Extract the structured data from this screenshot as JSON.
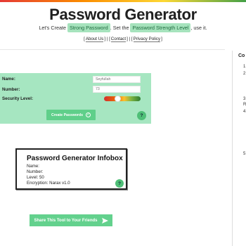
{
  "header": {
    "title": "Password Generator",
    "subtitle": {
      "prefix": "Let's Create",
      "highlight1": "Strong Password",
      "middle": ". Set the",
      "highlight2": "Password Strength Level",
      "suffix": ", use it."
    },
    "links": {
      "about": "About Us",
      "contact": "Contact",
      "privacy": "Privacy Policy"
    }
  },
  "form": {
    "name_label": "Name:",
    "name_placeholder": "Seyfullah",
    "number_label": "Number:",
    "number_placeholder": "73",
    "security_label": "Security Level:",
    "security_level_fraction": 0.35,
    "create_button": "Create Passwords",
    "help": "?"
  },
  "infobox": {
    "title": "Password Generator Infobox",
    "name_line": "Name:",
    "number_line": "Number:",
    "level_line": "Level: 50",
    "encryption_line": "Encryption: Narax v1.0",
    "help": "?"
  },
  "share_button": "Share This Tool to Your Friends",
  "right_panel": {
    "heading": "Co",
    "items": [
      "1.",
      "2.",
      "3.",
      "R",
      "4.",
      "5."
    ]
  },
  "colors": {
    "accent_green": "#63d18d",
    "panel_green": "#a6e6c1",
    "highlight_bg": "#a6e3bd"
  }
}
